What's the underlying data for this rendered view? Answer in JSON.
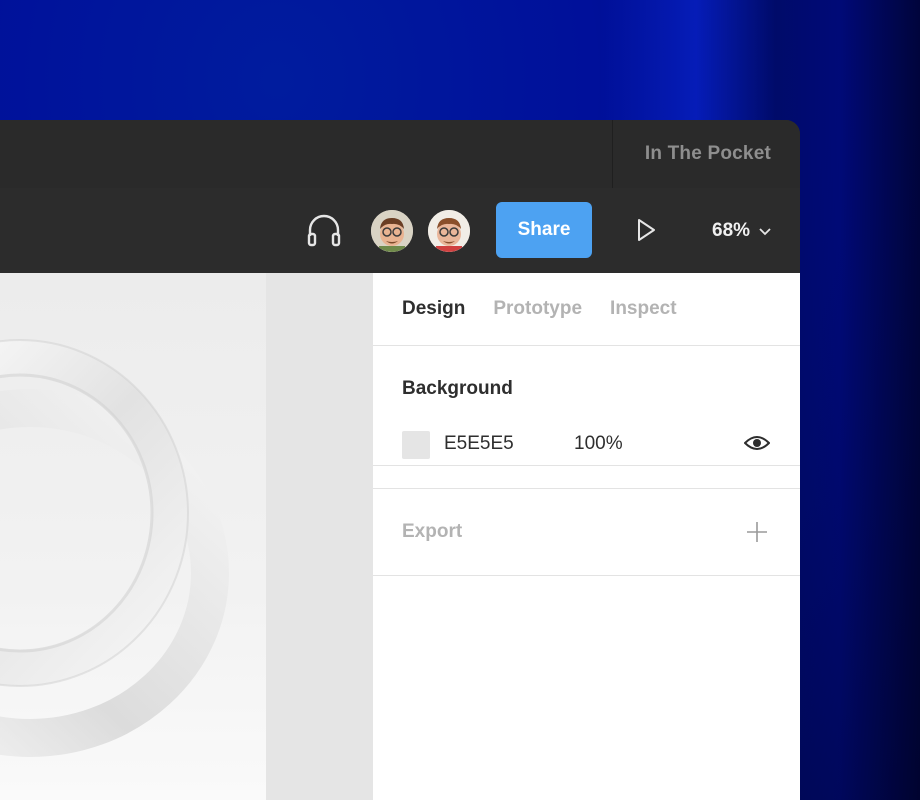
{
  "window": {
    "team_name": "In The Pocket"
  },
  "toolbar": {
    "headset_icon": "headphones-icon",
    "avatars": [
      {
        "icon": "avatar-memoji"
      },
      {
        "icon": "avatar-memoji"
      }
    ],
    "share_label": "Share",
    "play_icon": "play-icon",
    "zoom_label": "68%",
    "zoom_icon": "chevron-down-icon"
  },
  "panel": {
    "tabs": [
      {
        "label": "Design",
        "active": true
      },
      {
        "label": "Prototype",
        "active": false
      },
      {
        "label": "Inspect",
        "active": false
      }
    ],
    "background": {
      "title": "Background",
      "color_hex": "E5E5E5",
      "color_value": "#e5e5e5",
      "opacity": "100%",
      "visibility_icon": "eye-icon"
    },
    "export": {
      "title": "Export",
      "add_icon": "plus-icon"
    }
  },
  "colors": {
    "accent": "#4da2f2",
    "toolbar": "#2c2c2c",
    "canvas": "#e5e5e5"
  }
}
